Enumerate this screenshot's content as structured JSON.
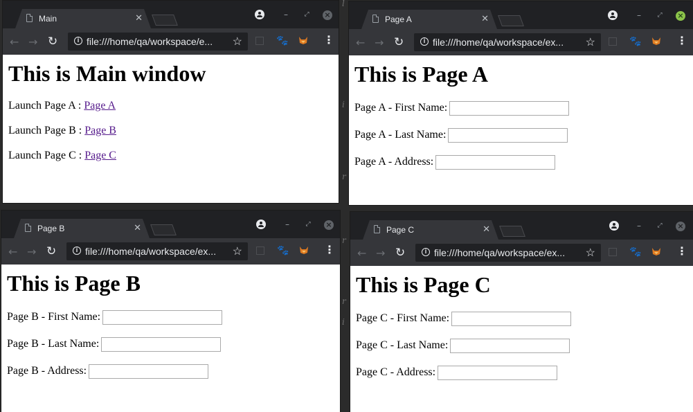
{
  "windows": {
    "main": {
      "tab_title": "Main",
      "url": "file:///home/qa/workspace/e...",
      "heading": "This is Main window",
      "links": [
        {
          "label": "Launch Page A : ",
          "link": "Page A"
        },
        {
          "label": "Launch Page B : ",
          "link": "Page B"
        },
        {
          "label": "Launch Page C : ",
          "link": "Page C"
        }
      ]
    },
    "page_a": {
      "tab_title": "Page A",
      "url": "file:///home/qa/workspace/ex...",
      "heading": "This is Page A",
      "fields": [
        {
          "label": "Page A - First Name:",
          "value": ""
        },
        {
          "label": "Page A - Last Name:",
          "value": ""
        },
        {
          "label": "Page A - Address:",
          "value": ""
        }
      ]
    },
    "page_b": {
      "tab_title": "Page B",
      "url": "file:///home/qa/workspace/ex...",
      "heading": "This is Page B",
      "fields": [
        {
          "label": "Page B - First Name:",
          "value": ""
        },
        {
          "label": "Page B - Last Name:",
          "value": ""
        },
        {
          "label": "Page B - Address:",
          "value": ""
        }
      ]
    },
    "page_c": {
      "tab_title": "Page C",
      "url": "file:///home/qa/workspace/ex...",
      "heading": "This is Page C",
      "fields": [
        {
          "label": "Page C - First Name:",
          "value": ""
        },
        {
          "label": "Page C - Last Name:",
          "value": ""
        },
        {
          "label": "Page C - Address:",
          "value": ""
        }
      ]
    }
  },
  "chrome": {
    "tab_close_glyph": "✕",
    "back_glyph": "←",
    "forward_glyph": "→",
    "reload_glyph": "↻",
    "star_glyph": "☆",
    "menu_glyph": "⋮",
    "minimize_glyph": "–",
    "restore_glyph": "⤢",
    "close_glyph": "×"
  },
  "colors": {
    "link": "#551a8b",
    "chrome_dark": "#202124",
    "toolbar": "#35363a",
    "active_close": "#8bc34a"
  }
}
